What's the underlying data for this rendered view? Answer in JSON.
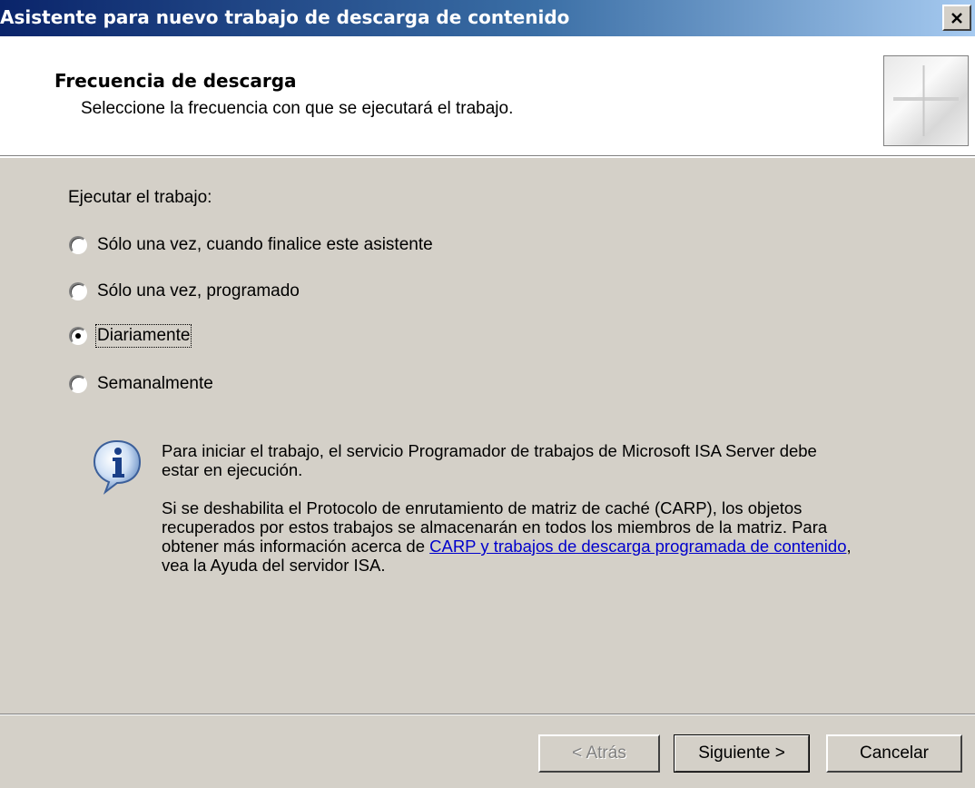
{
  "window": {
    "title": "Asistente para nuevo trabajo de descarga de contenido",
    "close_icon": "close-icon"
  },
  "header": {
    "title": "Frecuencia de descarga",
    "subtitle": "Seleccione la frecuencia con que se ejecutará el trabajo."
  },
  "schedule": {
    "label": "Ejecutar el trabajo:",
    "selected": "Diariamente",
    "options": [
      {
        "label": "Sólo una vez, cuando finalice este asistente",
        "checked": false
      },
      {
        "label": "Sólo una vez, programado",
        "checked": false
      },
      {
        "label": "Diariamente",
        "checked": true
      },
      {
        "label": "Semanalmente",
        "checked": false
      }
    ]
  },
  "info": {
    "icon": "info-icon",
    "paragraph1": "Para iniciar el trabajo, el servicio Programador de trabajos de Microsoft ISA Server debe estar en ejecución.",
    "paragraph2_before": "Si se deshabilita el Protocolo de enrutamiento de matriz de caché (CARP), los objetos recuperados por estos trabajos se almacenarán en todos los miembros de la matriz. Para obtener más información acerca de ",
    "link_text": "CARP y trabajos de descarga programada de contenido",
    "paragraph2_after": ", vea la Ayuda del servidor ISA."
  },
  "buttons": {
    "back": "< Atrás",
    "next": "Siguiente >",
    "cancel": "Cancelar"
  },
  "colors": {
    "title_gradient_start": "#0a246a",
    "title_gradient_end": "#a6caf0",
    "dialog_face": "#d4d0c8",
    "link": "#0000cc"
  }
}
